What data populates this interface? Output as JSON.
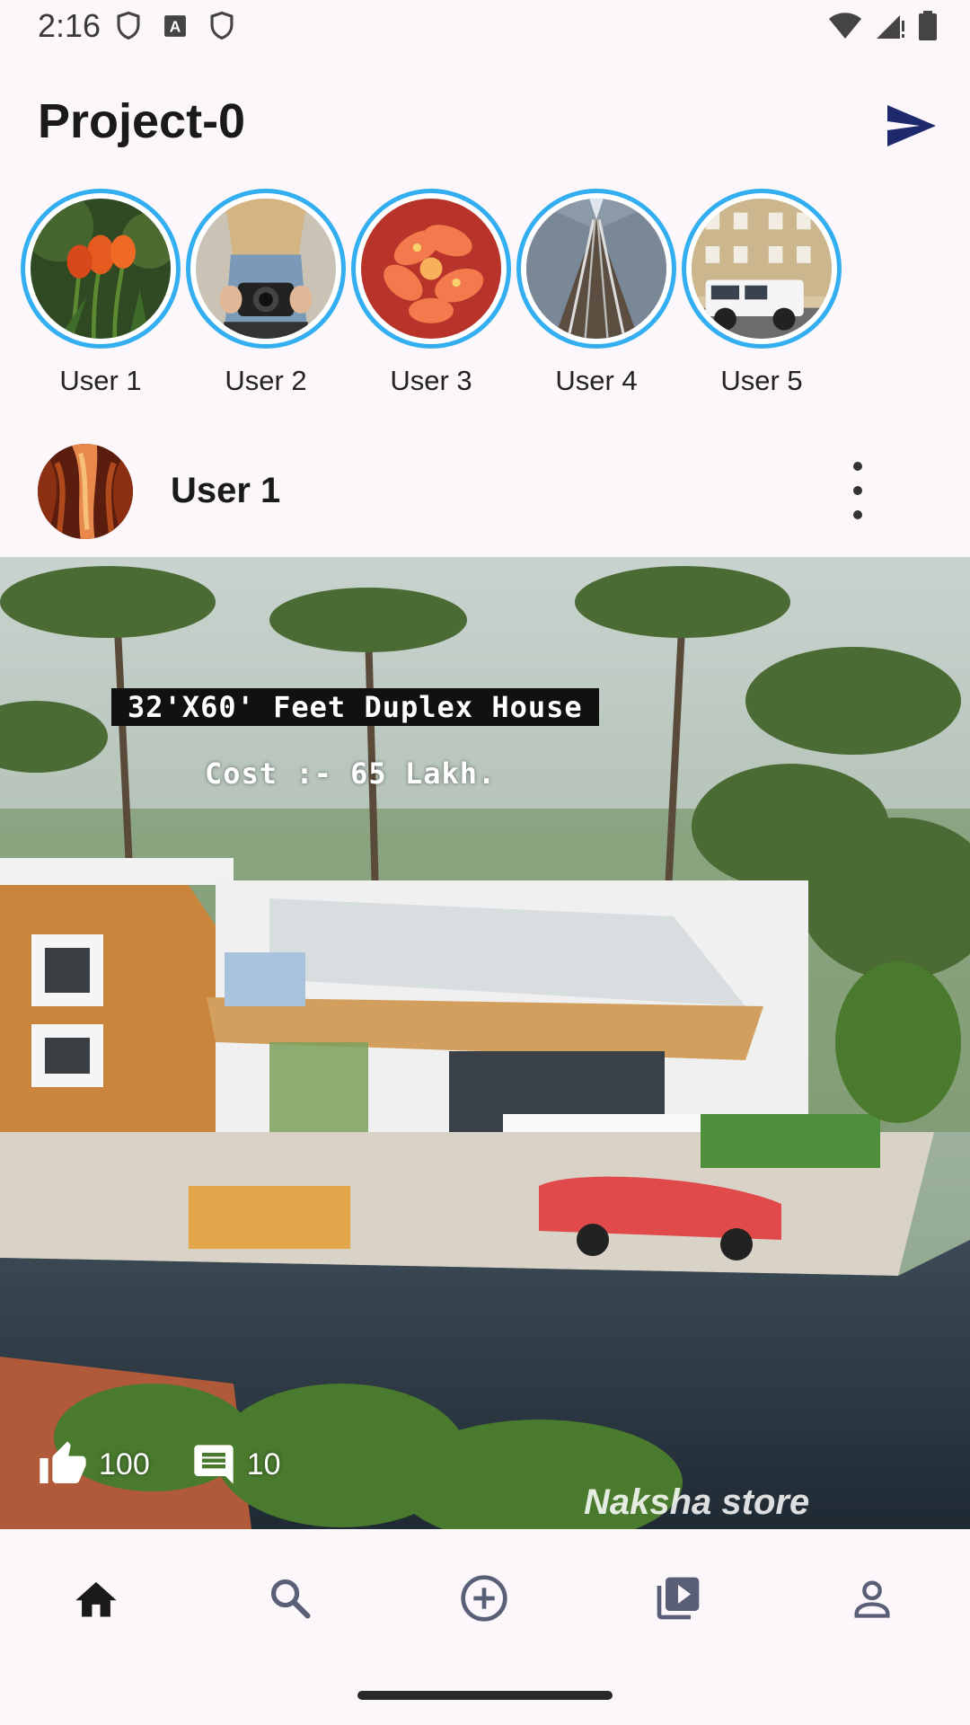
{
  "status_bar": {
    "time": "2:16",
    "left_icons": [
      "shield-icon",
      "a-box-icon",
      "shield-icon"
    ],
    "right_icons": [
      "wifi-icon",
      "signal-icon",
      "battery-icon"
    ]
  },
  "header": {
    "title": "Project-0",
    "send_icon": "send-icon",
    "accent": "#1F2A6E"
  },
  "stories": [
    {
      "label": "User 1",
      "image": "tulips"
    },
    {
      "label": "User 2",
      "image": "camera-person"
    },
    {
      "label": "User 3",
      "image": "orange-flowers"
    },
    {
      "label": "User 4",
      "image": "railway-tracks"
    },
    {
      "label": "User 5",
      "image": "white-suv-building"
    }
  ],
  "post": {
    "username": "User 1",
    "caption_line1": "32'X60' Feet Duplex House",
    "caption_line2": "Cost :- 65 Lakh.",
    "watermark": "Naksha store",
    "likes": "100",
    "comments": "10"
  },
  "bottom_nav": {
    "items": [
      {
        "icon": "home-icon",
        "active": true
      },
      {
        "icon": "search-icon",
        "active": false
      },
      {
        "icon": "add-circle-icon",
        "active": false
      },
      {
        "icon": "video-library-icon",
        "active": false
      },
      {
        "icon": "profile-icon",
        "active": false
      }
    ]
  },
  "colors": {
    "background": "#FCF7FB",
    "story_ring": "#33AEF0",
    "nav_active": "#1A1A1A",
    "nav_inactive": "#5A5F78"
  }
}
